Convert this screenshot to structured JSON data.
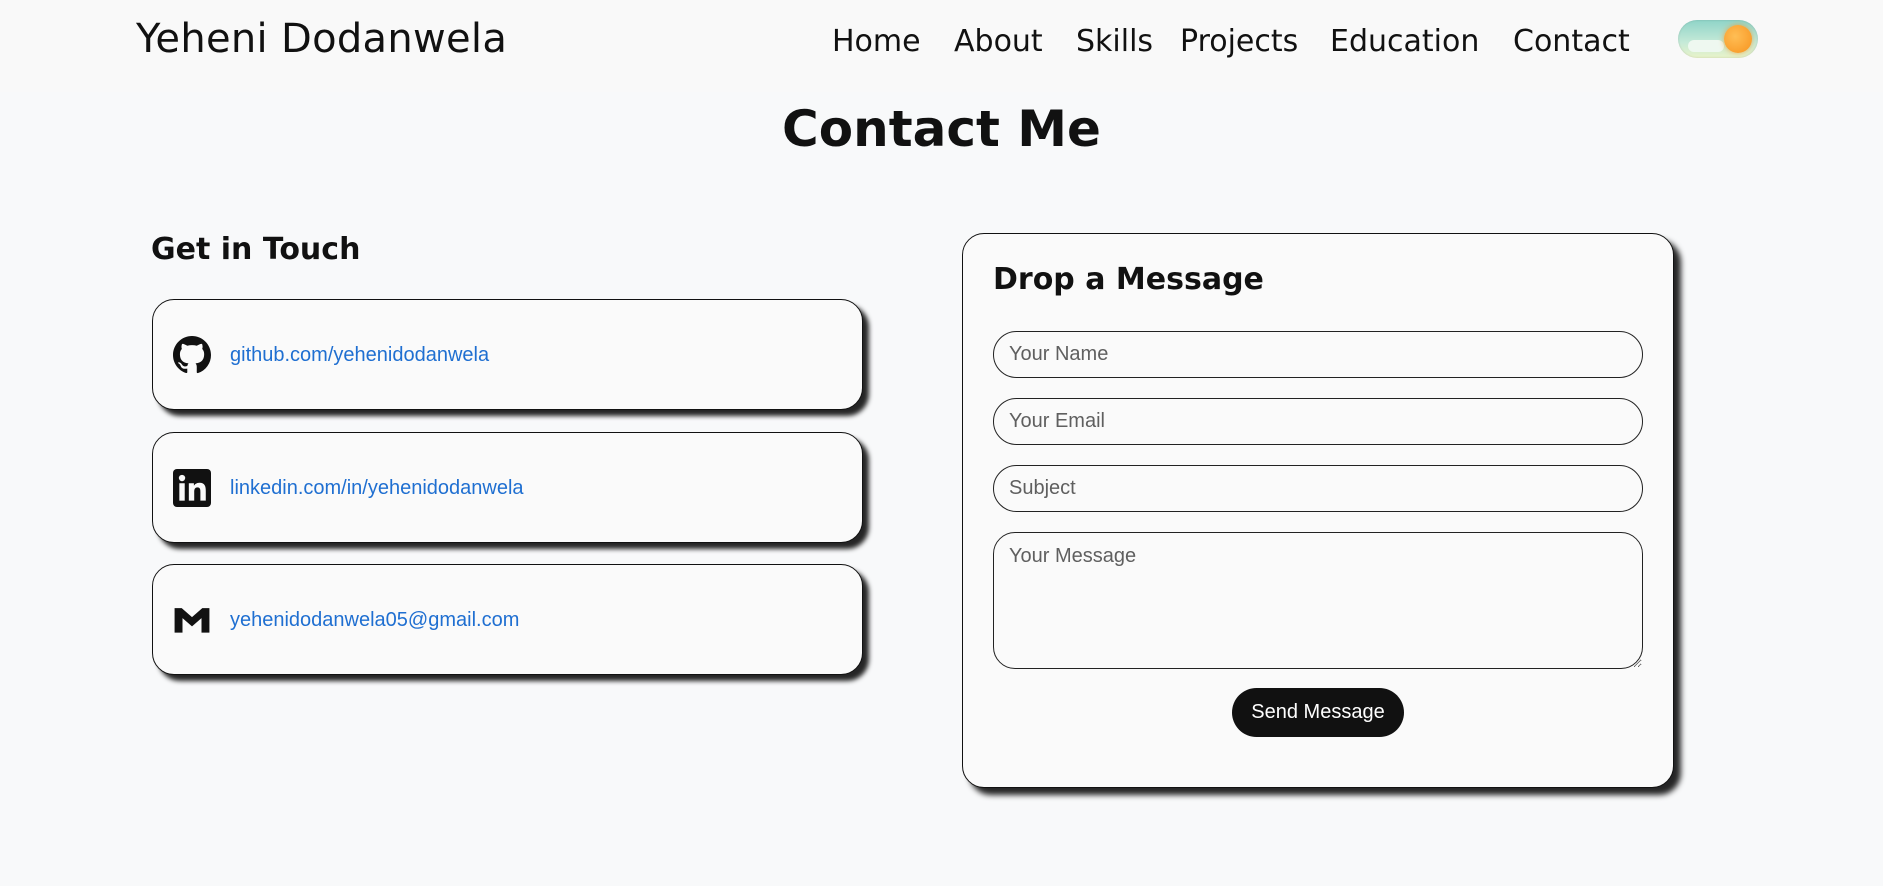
{
  "header": {
    "brand": "Yeheni Dodanwela",
    "nav": [
      {
        "label": "Home"
      },
      {
        "label": "About"
      },
      {
        "label": "Skills"
      },
      {
        "label": "Projects"
      },
      {
        "label": "Education"
      },
      {
        "label": "Contact"
      }
    ],
    "theme_toggle_icon": "sun-icon"
  },
  "main": {
    "title": "Contact Me",
    "contact": {
      "heading": "Get in Touch",
      "items": [
        {
          "icon": "github-icon",
          "text": "github.com/yehenidodanwela"
        },
        {
          "icon": "linkedin-icon",
          "text": "linkedin.com/in/yehenidodanwela"
        },
        {
          "icon": "gmail-icon",
          "text": "yehenidodanwela05@gmail.com"
        }
      ]
    },
    "form": {
      "title": "Drop a Message",
      "name_placeholder": "Your Name",
      "email_placeholder": "Your Email",
      "subject_placeholder": "Subject",
      "message_placeholder": "Your Message",
      "submit_label": "Send Message"
    }
  },
  "colors": {
    "background": "#f8f9fa",
    "link": "#1f6fd1",
    "button": "#111111",
    "toggle_sun": "#f7931e"
  }
}
